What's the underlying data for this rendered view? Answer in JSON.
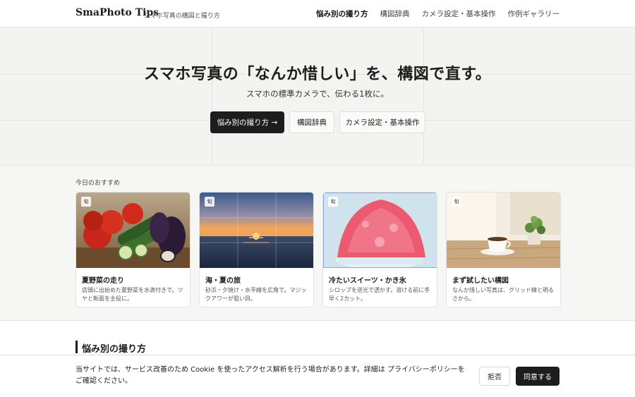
{
  "header": {
    "brand": "SmaPhoto Tips",
    "tagline": "スマホ写真の構図と撮り方",
    "nav": [
      {
        "label": "悩み別の撮り方",
        "active": true
      },
      {
        "label": "構図辞典",
        "active": false
      },
      {
        "label": "カメラ設定・基本操作",
        "active": false
      },
      {
        "label": "作例ギャラリー",
        "active": false
      }
    ]
  },
  "hero": {
    "title": "スマホ写真の「なんか惜しい」を、構図で直す。",
    "subtitle": "スマホの標準カメラで、伝わる1枚に。",
    "buttons": {
      "primary": "悩み別の撮り方 →",
      "dictionary": "構図辞典",
      "settings": "カメラ設定・基本操作"
    }
  },
  "picks": {
    "label": "今日のおすすめ",
    "cards": [
      {
        "badge": "旬",
        "title": "夏野菜の走り",
        "desc": "店頭に出始めた夏野菜を水滴付きで。ツヤと断面を主役に。"
      },
      {
        "badge": "旬",
        "title": "海・夏の旅",
        "desc": "砂浜・夕焼け・水平線を広角で。マジックアワーが狙い目。"
      },
      {
        "badge": "旬",
        "title": "冷たいスイーツ・かき氷",
        "desc": "シロップを逆光で透かす。溶ける前に手早く2カット。"
      },
      {
        "badge": "旬",
        "title": "まず試したい構図",
        "desc": "なんか惜しい写真は、グリッド線と明るさから。"
      }
    ]
  },
  "section": {
    "title": "悩み別の撮り方"
  },
  "cookie": {
    "text": "当サイトでは、サービス改善のため Cookie を使ったアクセス解析を行う場合があります。詳細は プライバシーポリシーをご確認ください。",
    "reject": "拒否",
    "accept": "同意する"
  },
  "colors": {
    "accent": "#1d1d1d",
    "background": "#f4f4f2"
  }
}
